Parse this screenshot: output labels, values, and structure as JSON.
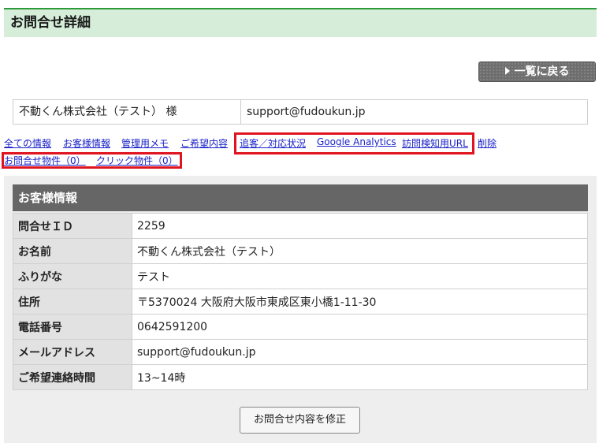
{
  "header": {
    "title": "お問合せ詳細"
  },
  "toolbar": {
    "back_label": "一覧に戻る"
  },
  "customer": {
    "name": "不動くん株式会社（テスト） 様",
    "email": "support@fudoukun.jp"
  },
  "links": [
    "全ての情報",
    "お客様情報",
    "管理用メモ",
    "ご希望内容",
    "追客／対応状況",
    "Google Analytics",
    "訪問検知用URL",
    "削除",
    "お問合せ物件（0）",
    "クリック物件（0）"
  ],
  "panel": {
    "title": "お客様情報",
    "rows": [
      {
        "label": "問合せＩＤ",
        "value": "2259"
      },
      {
        "label": "お名前",
        "value": "不動くん株式会社（テスト）"
      },
      {
        "label": "ふりがな",
        "value": "テスト"
      },
      {
        "label": "住所",
        "value": "〒5370024 大阪府大阪市東成区東小橋1-11-30"
      },
      {
        "label": "電話番号",
        "value": "0642591200"
      },
      {
        "label": "メールアドレス",
        "value": "support@fudoukun.jp"
      },
      {
        "label": "ご希望連絡時間",
        "value": "13~14時"
      }
    ],
    "edit_label": "お問合せ内容を修正"
  },
  "colors": {
    "header_bg": "#d6eed9",
    "header_border": "#2d9a3a",
    "highlight": "#e0141f",
    "link": "#1a22c8"
  }
}
